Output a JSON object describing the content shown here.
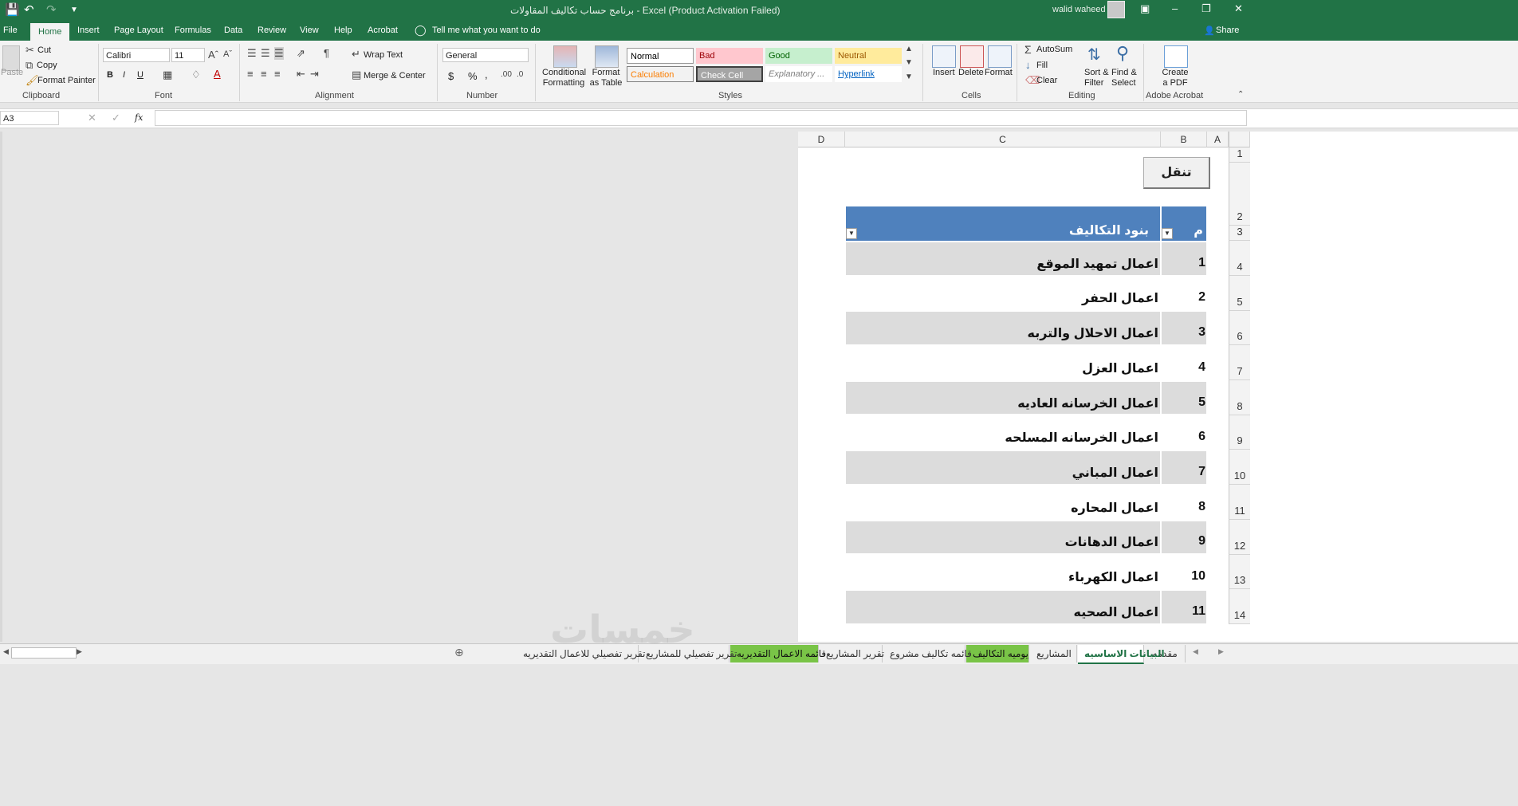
{
  "window": {
    "title": "برنامج حساب تكاليف المقاولات  -  Excel (Product Activation Failed)",
    "user": "walid waheed"
  },
  "menu": {
    "tabs": [
      "File",
      "Home",
      "Insert",
      "Page Layout",
      "Formulas",
      "Data",
      "Review",
      "View",
      "Help",
      "Acrobat"
    ],
    "active": "Home",
    "tell_me": "Tell me what you want to do",
    "share": "Share"
  },
  "ribbon": {
    "clipboard": {
      "paste": "Paste",
      "cut": "Cut",
      "copy": "Copy",
      "format_painter": "Format Painter",
      "label": "Clipboard"
    },
    "font": {
      "name": "Calibri",
      "size": "11",
      "bold": "B",
      "italic": "I",
      "underline": "U",
      "label": "Font"
    },
    "alignment": {
      "wrap_text": "Wrap Text",
      "merge_center": "Merge & Center",
      "label": "Alignment"
    },
    "number": {
      "format": "General",
      "currency": "$",
      "percent": "%",
      "comma": ",",
      "label": "Number"
    },
    "styles": {
      "conditional_formatting": "Conditional Formatting",
      "format_as_table": "Format as Table",
      "cells": [
        {
          "name": "Normal",
          "bg": "#ffffff",
          "fg": "#000000"
        },
        {
          "name": "Bad",
          "bg": "#ffc7ce",
          "fg": "#9c0006"
        },
        {
          "name": "Good",
          "bg": "#c6efce",
          "fg": "#006100"
        },
        {
          "name": "Neutral",
          "bg": "#ffeb9c",
          "fg": "#9c5700"
        },
        {
          "name": "Calculation",
          "bg": "#f2f2f2",
          "fg": "#fa7d00"
        },
        {
          "name": "Check Cell",
          "bg": "#a5a5a5",
          "fg": "#ffffff"
        },
        {
          "name": "Explanatory ...",
          "bg": "#ffffff",
          "fg": "#7f7f7f"
        },
        {
          "name": "Hyperlink",
          "bg": "#ffffff",
          "fg": "#0563c1"
        }
      ],
      "label": "Styles"
    },
    "cells": {
      "insert": "Insert",
      "delete": "Delete",
      "format": "Format",
      "label": "Cells"
    },
    "editing": {
      "autosum": "AutoSum",
      "fill": "Fill",
      "clear": "Clear",
      "sort_filter": "Sort & Filter",
      "find_select": "Find & Select",
      "label": "Editing"
    },
    "acrobat": {
      "create_pdf": "Create a PDF",
      "label": "Adobe Acrobat"
    }
  },
  "formula_bar": {
    "name_box": "A3",
    "fx": "fx",
    "content": ""
  },
  "sheet": {
    "columns": [
      "D",
      "C",
      "B",
      "A"
    ],
    "rows": [
      "1",
      "2",
      "3",
      "4",
      "5",
      "6",
      "7",
      "8",
      "9",
      "10",
      "11",
      "12",
      "13",
      "14"
    ],
    "nav_button": "تنقل",
    "table_header": {
      "index": "م",
      "item": "بنود التكاليف"
    },
    "header_color": "#4f81bd",
    "band_color": "#dcdcdc",
    "items": [
      {
        "n": "1",
        "label": "اعمال تمهيد الموقع"
      },
      {
        "n": "2",
        "label": "اعمال الحفر"
      },
      {
        "n": "3",
        "label": "اعمال الاحلال والتربه"
      },
      {
        "n": "4",
        "label": "اعمال العزل"
      },
      {
        "n": "5",
        "label": "اعمال الخرسانه العاديه"
      },
      {
        "n": "6",
        "label": "اعمال الخرسانه المسلحه"
      },
      {
        "n": "7",
        "label": "اعمال المباني"
      },
      {
        "n": "8",
        "label": "اعمال المحاره"
      },
      {
        "n": "9",
        "label": "اعمال الدهانات"
      },
      {
        "n": "10",
        "label": "اعمال الكهرباء"
      },
      {
        "n": "11",
        "label": "اعمال الصحيه"
      }
    ]
  },
  "sheet_tabs": [
    {
      "label": "مقدمه",
      "style": "normal"
    },
    {
      "label": "البيانات الاساسيه",
      "style": "active"
    },
    {
      "label": "المشاريع",
      "style": "normal"
    },
    {
      "label": "يوميه التكاليف",
      "style": "green"
    },
    {
      "label": "قائمه تكاليف مشروع",
      "style": "normal"
    },
    {
      "label": "تقرير المشاريع",
      "style": "normal"
    },
    {
      "label": "قائمه الاعمال التقديريه",
      "style": "green"
    },
    {
      "label": "تقرير تفصيلي للمشاريع",
      "style": "normal"
    },
    {
      "label": "تقرير تفصيلي للاعمال التقديريه",
      "style": "normal"
    }
  ],
  "watermark": "خمسات"
}
